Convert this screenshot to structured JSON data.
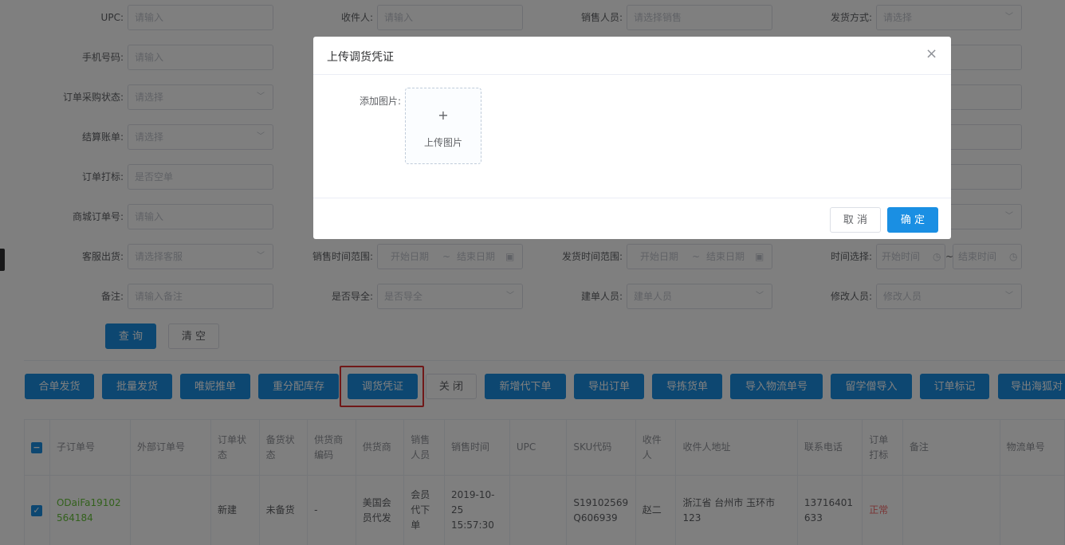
{
  "form": {
    "upc_label": "UPC:",
    "upc_placeholder": "请输入",
    "receiver_label": "收件人:",
    "receiver_placeholder": "请输入",
    "sales_label": "销售人员:",
    "sales_placeholder": "请选择销售",
    "ship_method_label": "发货方式:",
    "ship_method_placeholder": "请选择",
    "phone_label": "手机号码:",
    "phone_placeholder": "请输入",
    "purchase_status_label": "订单采购状态:",
    "purchase_status_placeholder": "请选择",
    "settle_label": "结算账单:",
    "settle_placeholder": "请选择",
    "mark_label": "订单打标:",
    "mark_placeholder": "是否空单",
    "mall_no_label": "商城订单号:",
    "mall_no_placeholder": "请输入",
    "cs_ship_label": "客服出货:",
    "cs_ship_placeholder": "请选择客服",
    "sales_time_label": "销售时间范围:",
    "ship_time_label": "发货时间范围:",
    "time_select_label": "时间选择:",
    "start_date": "开始日期",
    "end_date": "结束日期",
    "start_time": "开始时间",
    "end_time": "结束时间",
    "range_sep": "~",
    "remark_label": "备注:",
    "remark_placeholder": "请输入备注",
    "guide_label": "是否导全:",
    "guide_placeholder": "是否导全",
    "creator_label": "建单人员:",
    "creator_placeholder": "建单人员",
    "modifier_label": "修改人员:",
    "modifier_placeholder": "修改人员",
    "query_button": "查 询",
    "clear_button": "清 空"
  },
  "toolbar": {
    "merge_ship": "合单发货",
    "batch_ship": "批量发货",
    "weini_push": "唯妮推单",
    "realloc_stock": "重分配库存",
    "transfer_voucher": "调货凭证",
    "close": "关 闭",
    "new_agent_order": "新增代下单",
    "export_order": "导出订单",
    "export_pick": "导拣货单",
    "import_logistics": "导入物流单号",
    "liuxue_import": "留学僧导入",
    "order_mark": "订单标记",
    "export_haihu": "导出海狐对"
  },
  "table": {
    "headers": [
      "子订单号",
      "外部订单号",
      "订单状态",
      "备货状态",
      "供货商编码",
      "供货商",
      "销售人员",
      "销售时间",
      "UPC",
      "SKU代码",
      "收件人",
      "收件人地址",
      "联系电话",
      "订单打标",
      "备注",
      "物流单号"
    ],
    "row": {
      "sub_order_no": "ODaiFa19102564184",
      "external_no": "",
      "order_status": "新建",
      "stock_status": "未备货",
      "supplier_code": "-",
      "supplier": "美国会员代发",
      "sales_person": "会员代下单",
      "sales_time": "2019-10-25 15:57:30",
      "upc": "",
      "sku": "S19102569Q606939",
      "receiver": "赵二",
      "address": "浙江省 台州市 玉环市 123",
      "phone": "13716401633",
      "mark": "正常",
      "remark": "",
      "logistics_no": ""
    }
  },
  "dialog": {
    "title": "上传调货凭证",
    "close_icon": "×",
    "add_image_label": "添加图片:",
    "plus": "+",
    "upload_text": "上传图片",
    "cancel": "取 消",
    "confirm": "确 定"
  },
  "icons": {
    "chevron": "﹀",
    "calendar": "▣",
    "clock": "◷",
    "check": "✓"
  },
  "colors": {
    "primary": "#1a8fe3",
    "highlight_box": "#e03131",
    "order_link": "#67c23a",
    "status_red": "#f56c6c"
  }
}
